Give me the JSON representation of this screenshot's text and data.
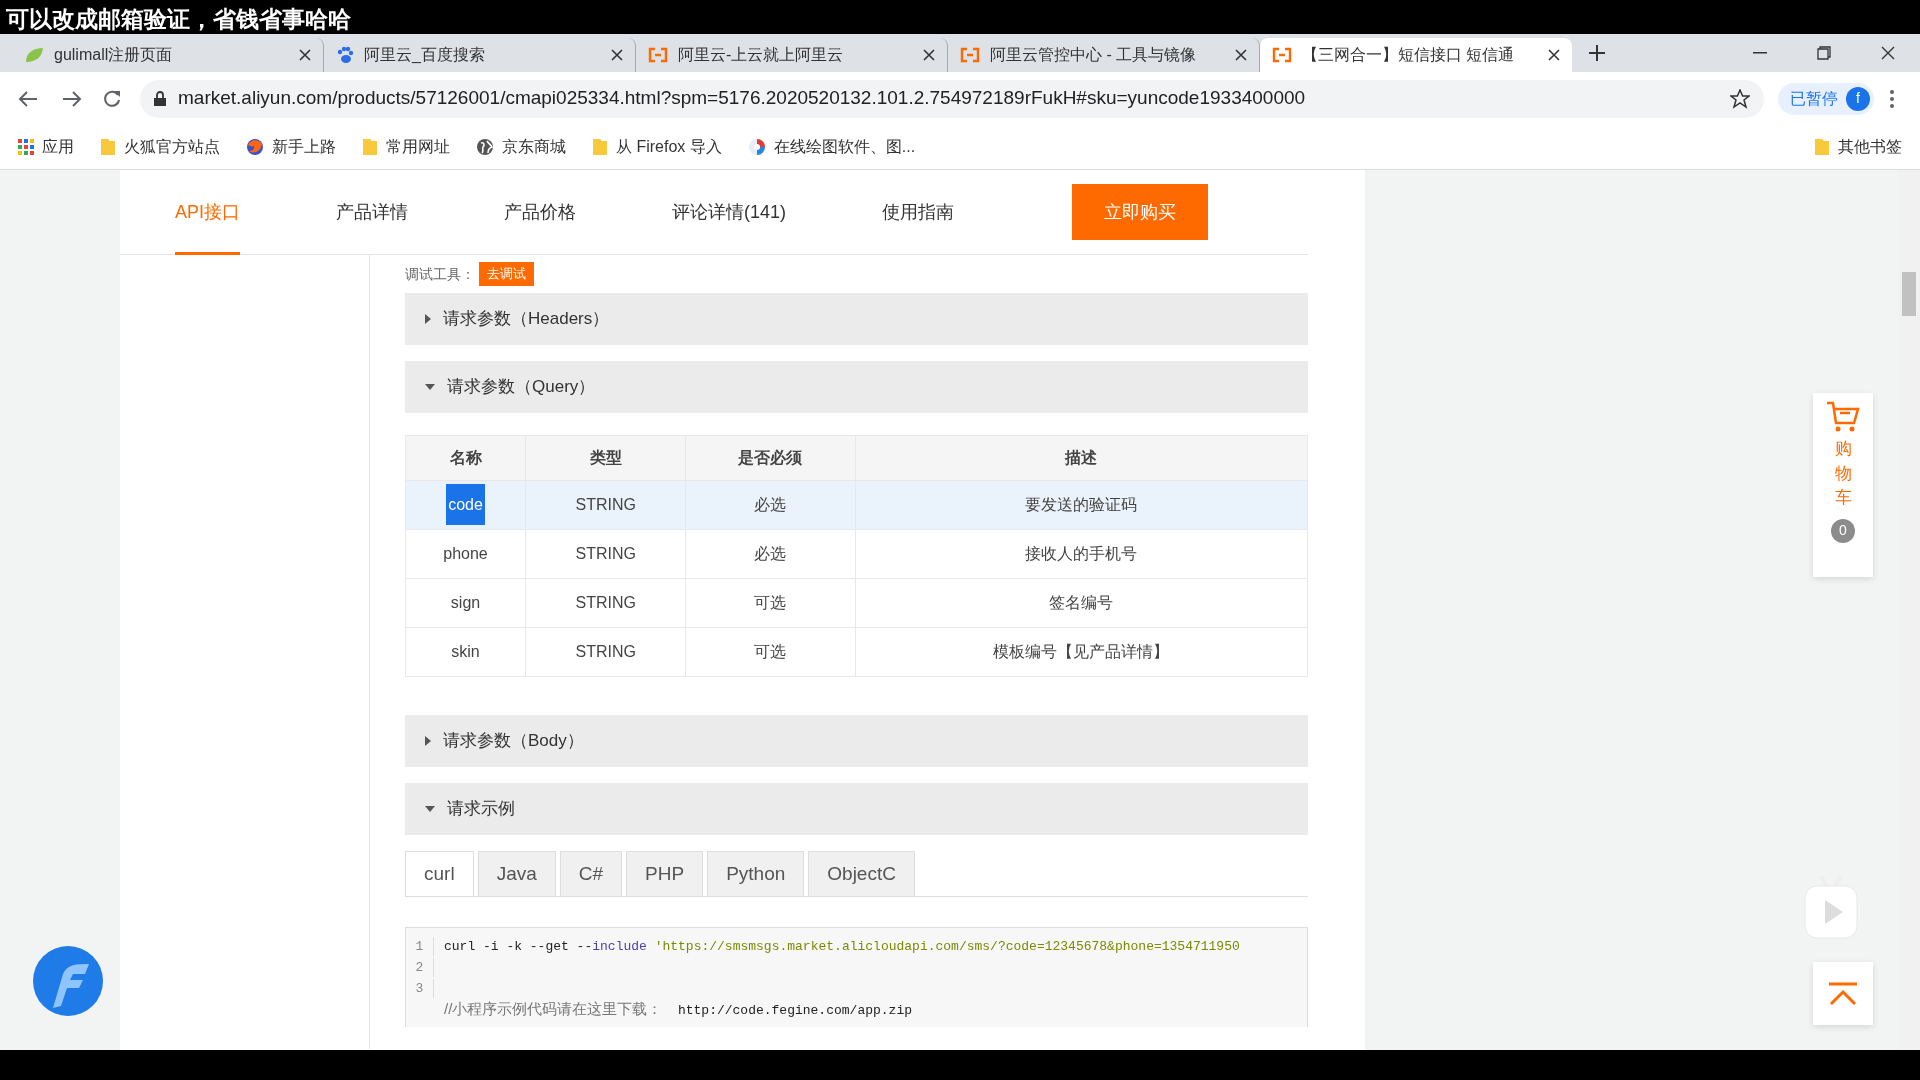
{
  "caption": "可以改成邮箱验证，省钱省事哈哈",
  "browser": {
    "tabs": [
      {
        "title": "gulimall注册页面",
        "kind": "leaf",
        "selected": false
      },
      {
        "title": "阿里云_百度搜索",
        "kind": "paw",
        "selected": false
      },
      {
        "title": "阿里云-上云就上阿里云",
        "kind": "bracket",
        "selected": false
      },
      {
        "title": "阿里云管控中心 - 工具与镜像",
        "kind": "bracket",
        "selected": false
      },
      {
        "title": "【三网合一】短信接口 短信通",
        "kind": "bracket",
        "selected": true
      }
    ],
    "url": "market.aliyun.com/products/57126001/cmapi025334.html?spm=5176.2020520132.101.2.754972189rFukH#sku=yuncode1933400000",
    "profile": {
      "label": "已暂停",
      "initial": "f"
    },
    "bookmarks": [
      {
        "label": "应用",
        "kind": "apps"
      },
      {
        "label": "火狐官方站点",
        "kind": "folder"
      },
      {
        "label": "新手上路",
        "kind": "browser"
      },
      {
        "label": "常用网址",
        "kind": "folder"
      },
      {
        "label": "京东商城",
        "kind": "globe"
      },
      {
        "label": "从 Firefox 导入",
        "kind": "folder"
      },
      {
        "label": "在线绘图软件、图...",
        "kind": "site"
      }
    ],
    "other_bookmarks": "其他书签"
  },
  "page": {
    "nav": [
      {
        "label": "API接口",
        "selected": true
      },
      {
        "label": "产品详情",
        "selected": false
      },
      {
        "label": "产品价格",
        "selected": false
      },
      {
        "label": "评论详情(141)",
        "selected": false
      },
      {
        "label": "使用指南",
        "selected": false
      }
    ],
    "buy_button": "立即购买",
    "debug": {
      "label": "调试工具：",
      "button": "去调试"
    },
    "panels": [
      {
        "title": "请求参数（Headers）",
        "expanded": false
      },
      {
        "title": "请求参数（Query）",
        "expanded": true,
        "table": {
          "columns": [
            "名称",
            "类型",
            "是否必须",
            "描述"
          ],
          "rows": [
            {
              "cells": [
                "code",
                "STRING",
                "必选",
                "要发送的验证码"
              ],
              "hovered": true,
              "name_selected": true
            },
            {
              "cells": [
                "phone",
                "STRING",
                "必选",
                "接收人的手机号"
              ],
              "hovered": false,
              "name_selected": false
            },
            {
              "cells": [
                "sign",
                "STRING",
                "可选",
                "签名编号"
              ],
              "hovered": false,
              "name_selected": false
            },
            {
              "cells": [
                "skin",
                "STRING",
                "可选",
                "模板编号【见产品详情】"
              ],
              "hovered": false,
              "name_selected": false
            }
          ]
        }
      },
      {
        "title": "请求参数（Body）",
        "expanded": false
      },
      {
        "title": "请求示例",
        "expanded": true,
        "code_tabs": [
          {
            "label": "curl",
            "selected": true
          },
          {
            "label": "Java",
            "selected": false
          },
          {
            "label": "C#",
            "selected": false
          },
          {
            "label": "PHP",
            "selected": false
          },
          {
            "label": "Python",
            "selected": false
          },
          {
            "label": "ObjectC",
            "selected": false
          }
        ],
        "code_lines": [
          {
            "number": "1",
            "parts": [
              {
                "text": "curl -i -k --get --",
                "kind": "plain"
              },
              {
                "text": "include",
                "kind": "keyword"
              },
              {
                "text": " 'https://smsmsgs.market.alicloudapi.com/sms/?code=12345678&phone=1354711950",
                "kind": "string"
              }
            ]
          },
          {
            "number": "2"
          },
          {
            "number": "3"
          },
          {
            "parts": [
              {
                "text": "//小程序示例代码请在这里下载：",
                "kind": "comment"
              },
              {
                "text": "  http://code.fegine.com/app.zip",
                "kind": "plain"
              }
            ]
          }
        ]
      }
    ]
  },
  "cart": {
    "label": "购物车",
    "count": "0"
  }
}
